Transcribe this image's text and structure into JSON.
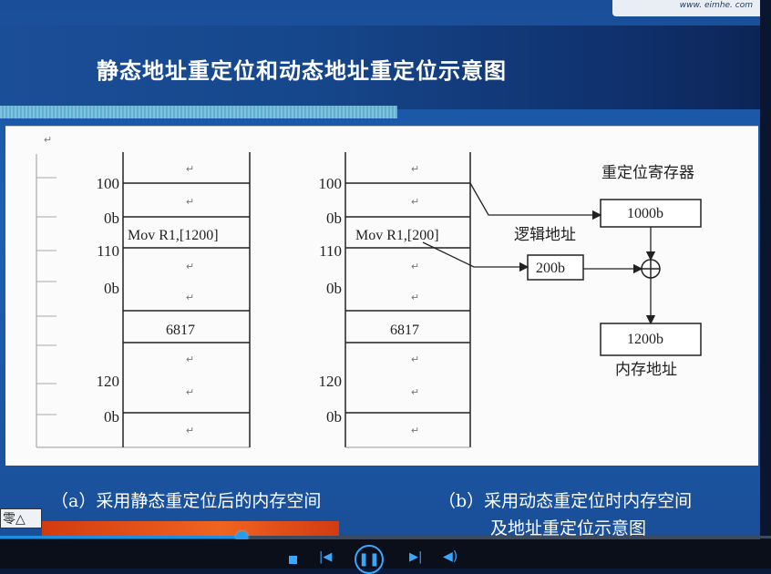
{
  "logo": {
    "text": "www. eimhe. com"
  },
  "slide": {
    "title": "静态地址重定位和动态地址重定位示意图",
    "caption_a": "（a）采用静态重定位后的内存空间",
    "caption_b_line1": "（b）采用动态重定位时内存空间",
    "caption_b_line2": "及地址重定位示意图",
    "corner_tab": "零△"
  },
  "diagram": {
    "return_mark": "↵",
    "left_memory": {
      "addresses": [
        "100",
        "0b",
        "110",
        "0b",
        "120",
        "0b"
      ],
      "instruction": "Mov R1,[1200]",
      "data": "6817"
    },
    "right_memory": {
      "addresses": [
        "100",
        "0b",
        "110",
        "0b",
        "120",
        "0b"
      ],
      "instruction": "Mov R1,[200]",
      "data": "6817"
    },
    "relocation_register_label": "重定位寄存器",
    "relocation_register_value": "1000b",
    "logical_address_label": "逻辑地址",
    "logical_address_value": "200b",
    "physical_address_value": "1200b",
    "physical_address_label": "内存地址"
  },
  "player": {
    "progress": 0.313,
    "accent": "#3aa7ff"
  }
}
